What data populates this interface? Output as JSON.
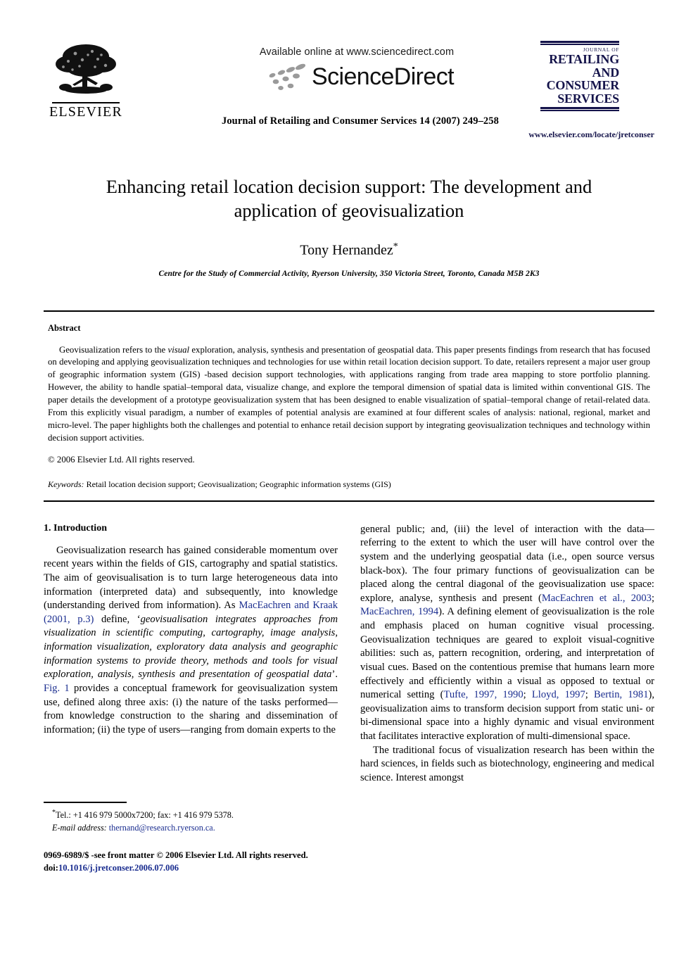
{
  "masthead": {
    "elsevier_wordmark": "ELSEVIER",
    "elsevier_logo_name": "elsevier-tree-logo",
    "available_online": "Available online at www.sciencedirect.com",
    "sciencedirect_wordmark": "ScienceDirect",
    "journal_citation": "Journal of Retailing and Consumer Services 14 (2007) 249–258",
    "journal_logo": {
      "kicker": "JOURNAL OF",
      "line1": "RETAILING",
      "line2": "AND",
      "line3": "CONSUMER",
      "line4": "SERVICES",
      "color": "#14134a"
    },
    "journal_url": "www.elsevier.com/locate/jretconser"
  },
  "article": {
    "title": "Enhancing retail location decision support: The development and application of geovisualization",
    "author": "Tony Hernandez",
    "author_marker": "*",
    "affiliation": "Centre for the Study of Commercial Activity, Ryerson University, 350 Victoria Street, Toronto, Canada M5B 2K3"
  },
  "abstract": {
    "heading": "Abstract",
    "body": "Geovisualization refers to the visual exploration, analysis, synthesis and presentation of geospatial data. This paper presents findings from research that has focused on developing and applying geovisualization techniques and technologies for use within retail location decision support. To date, retailers represent a major user group of geographic information system (GIS) -based decision support technologies, with applications ranging from trade area mapping to store portfolio planning. However, the ability to handle spatial–temporal data, visualize change, and explore the temporal dimension of spatial data is limited within conventional GIS. The paper details the development of a prototype geovisualization system that has been designed to enable visualization of spatial–temporal change of retail-related data. From this explicitly visual paradigm, a number of examples of potential analysis are examined at four different scales of analysis: national, regional, market and micro-level. The paper highlights both the challenges and potential to enhance retail decision support by integrating geovisualization techniques and technology within decision support activities.",
    "italic_word": "visual",
    "copyright": "© 2006 Elsevier Ltd. All rights reserved.",
    "keywords_label": "Keywords:",
    "keywords_value": "Retail location decision support; Geovisualization; Geographic information systems (GIS)"
  },
  "introduction": {
    "heading": "1.  Introduction",
    "left_col": {
      "p1_part1": "Geovisualization research has gained considerable momentum over recent years within the fields of GIS, cartography and spatial statistics. The aim of geovisualisation is to turn large heterogeneous data into information (interpreted data) and subsequently, into knowledge (understanding derived from information). As ",
      "p1_cite1": "MacEachren and Kraak (2001, p.3)",
      "p1_part2": " define, ‘",
      "p1_quote": "geovisualisation integrates approaches from visualization in scientific computing, cartography, image analysis, information visualization, exploratory data analysis and geographic information systems to provide theory, methods and tools for visual exploration, analysis, synthesis and presentation of geospatial data",
      "p1_part3": "’. ",
      "p1_cite2": "Fig. 1",
      "p1_part4": " provides a conceptual framework for geovisualization system use, defined along three axis: (i) the nature of the tasks performed—from knowledge construction to the sharing and dissemination of information; (ii) the type of users—ranging from domain experts to the"
    },
    "right_col": {
      "p1_part1": "general public; and, (iii) the level of interaction with the data—referring to the extent to which the user will have control over the system and the underlying geospatial data (i.e., open source versus black-box). The four primary functions of geovisualization can be placed along the central diagonal of the geovisualization use space: explore, analyse, synthesis and present (",
      "p1_cite1": "MacEachren et al., 2003",
      "p1_sep1": "; ",
      "p1_cite2": "MacEachren, 1994",
      "p1_part2": "). A defining element of geovisualization is the role and emphasis placed on human cognitive visual processing. Geovisualization techniques are geared to exploit visual-cognitive abilities: such as, pattern recognition, ordering, and interpretation of visual cues. Based on the contentious premise that humans learn more effectively and efficiently within a visual as opposed to textual or numerical setting (",
      "p1_cite3": "Tufte, 1997, 1990",
      "p1_sep2": "; ",
      "p1_cite4": "Lloyd, 1997",
      "p1_sep3": "; ",
      "p1_cite5": "Bertin, 1981",
      "p1_part3": "), geovisualization aims to transform decision support from static uni- or bi-dimensional space into a highly dynamic and visual environment that facilitates interactive exploration of multi-dimensional space.",
      "p2": "The traditional focus of visualization research has been within the hard sciences, in fields such as biotechnology, engineering and medical science. Interest amongst"
    }
  },
  "footnote": {
    "marker": "*",
    "tel_fax": "Tel.: +1 416 979 5000x7200; fax: +1 416 979 5378.",
    "email_label": "E-mail address:",
    "email_value": "thernand@research.ryerson.ca."
  },
  "footer": {
    "issn_line": "0969-6989/$ -see front matter © 2006 Elsevier Ltd. All rights reserved.",
    "doi_label": "doi:",
    "doi_value": "10.1016/j.jretconser.2006.07.006"
  },
  "colors": {
    "link": "#1a2d8f",
    "journal_navy": "#14134a",
    "text": "#000000",
    "background": "#ffffff"
  }
}
